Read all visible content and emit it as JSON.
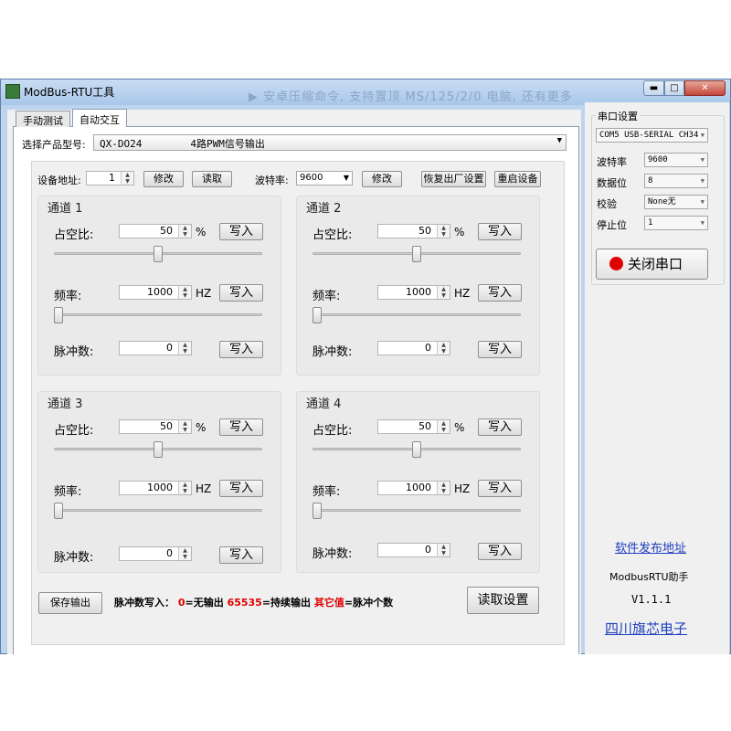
{
  "window": {
    "title": "ModBus-RTU工具",
    "ghost_text": "▶  安卓压缩命令, 支持置顶 MS/125/2/0 电脑, 还有更多",
    "min_label": "▬",
    "max_label": "□",
    "close_label": "✕"
  },
  "tabs": [
    {
      "label": "手动测试"
    },
    {
      "label": "自动交互"
    }
  ],
  "product": {
    "label": "选择产品型号:",
    "value": "QX-DO24        4路PWM信号输出"
  },
  "device": {
    "addr_label": "设备地址:",
    "addr_value": "1",
    "modify1": "修改",
    "read": "读取",
    "baud_label": "波特率:",
    "baud_value": "9600",
    "modify2": "修改",
    "factory_reset": "恢复出厂设置",
    "restart": "重启设备"
  },
  "channels": [
    {
      "title": "通道 1",
      "duty_label": "占空比:",
      "duty": "50",
      "duty_unit": "%",
      "freq_label": "频率:",
      "freq": "1000",
      "freq_unit": "HZ",
      "pulse_label": "脉冲数:",
      "pulse": "0",
      "write": "写入",
      "duty_level": 0.5,
      "freq_level": 0.0
    },
    {
      "title": "通道 2",
      "duty_label": "占空比:",
      "duty": "50",
      "duty_unit": "%",
      "freq_label": "频率:",
      "freq": "1000",
      "freq_unit": "HZ",
      "pulse_label": "脉冲数:",
      "pulse": "0",
      "write": "写入",
      "duty_level": 0.5,
      "freq_level": 0.0
    },
    {
      "title": "通道 3",
      "duty_label": "占空比:",
      "duty": "50",
      "duty_unit": "%",
      "freq_label": "频率:",
      "freq": "1000",
      "freq_unit": "HZ",
      "pulse_label": "脉冲数:",
      "pulse": "0",
      "write": "写入",
      "duty_level": 0.5,
      "freq_level": 0.0
    },
    {
      "title": "通道 4",
      "duty_label": "占空比:",
      "duty": "50",
      "duty_unit": "%",
      "freq_label": "频率:",
      "freq": "1000",
      "freq_unit": "HZ",
      "pulse_label": "脉冲数:",
      "pulse": "0",
      "write": "写入",
      "duty_level": 0.5,
      "freq_level": 0.0
    }
  ],
  "footer": {
    "save_output": "保存输出",
    "legend_prefix": "脉冲数写入：",
    "legend_zero": "0",
    "legend_zero_text": "=无输出",
    "legend_max": "65535",
    "legend_max_text": "=持续输出",
    "legend_other": "其它值",
    "legend_other_text": "=脉冲个数",
    "read_settings": "读取设置"
  },
  "serial": {
    "group_title": "串口设置",
    "port_value": "COM5 USB-SERIAL CH34",
    "baud_label": "波特率",
    "baud_value": "9600",
    "databits_label": "数据位",
    "databits_value": "8",
    "parity_label": "校验",
    "parity_value": "None无",
    "stopbits_label": "停止位",
    "stopbits_value": "1",
    "close_port": "关闭串口"
  },
  "info": {
    "release_link": "软件发布地址",
    "helper_name": "ModbusRTU助手",
    "version": "V1.1.1",
    "company": "四川旗芯电子"
  },
  "colors": {
    "accent_red": "#e00000",
    "link_blue": "#1f3fbf",
    "window_frame": "#bcd4ee"
  }
}
